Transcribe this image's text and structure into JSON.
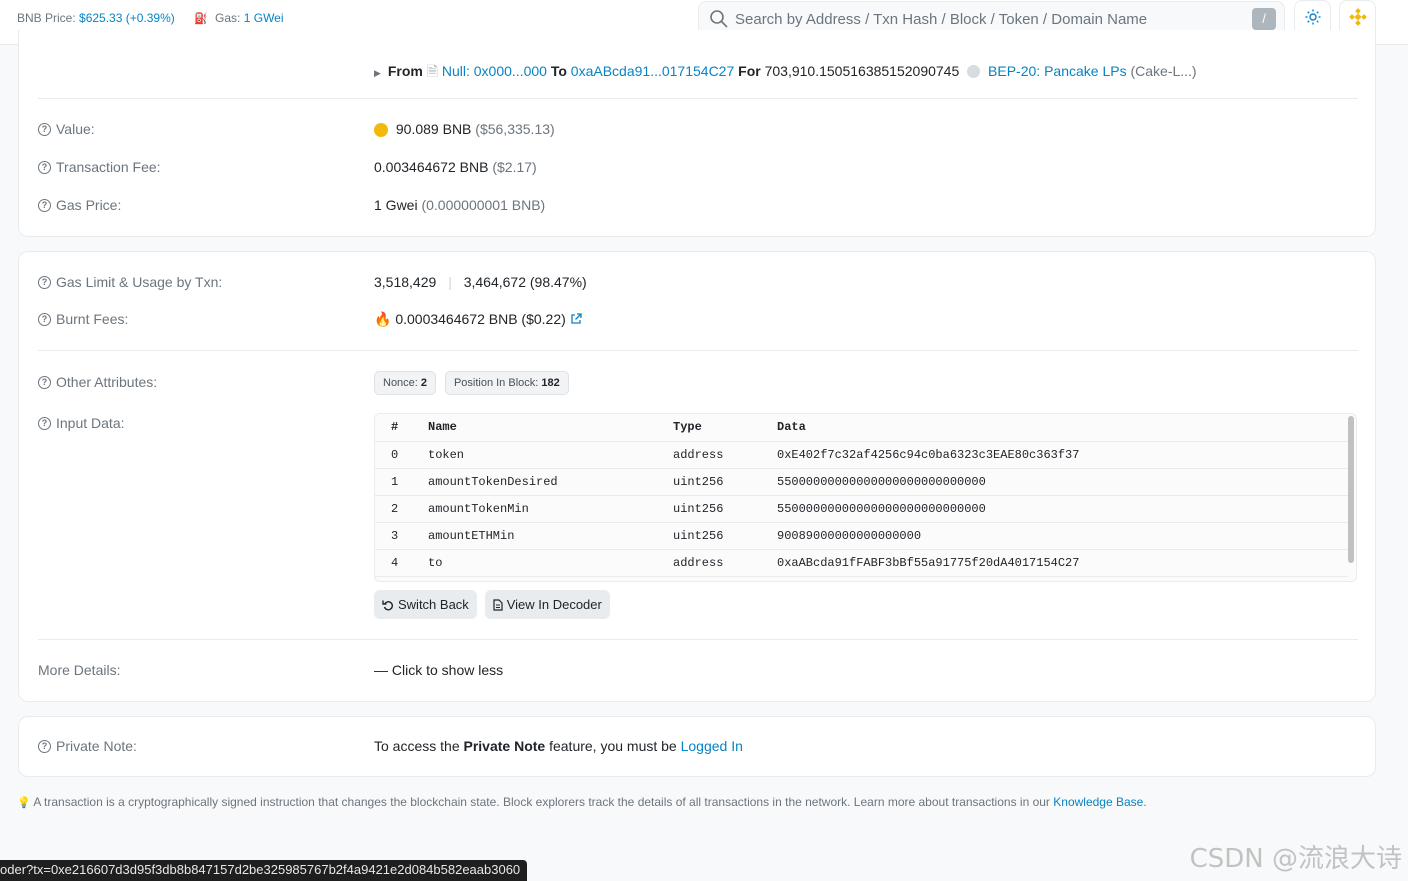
{
  "topbar": {
    "bnb_label": "BNB Price:",
    "bnb_value": "$625.33 (+0.39%)",
    "gas_label": "Gas:",
    "gas_value": "1 GWei",
    "search_placeholder": "Search by Address / Txn Hash / Block / Token / Domain Name",
    "search_shortcut": "/",
    "icons": [
      "search-icon",
      "theme-sun-icon",
      "bnb-logo-icon"
    ]
  },
  "transfer": {
    "from_label": "From",
    "from_value": "Null: 0x000...000",
    "to_label": "To",
    "to_value": "0xaABcda91...017154C27",
    "for_label": "For",
    "amount": "703,910.150516385152090745",
    "token_name": "BEP-20: Pancake LPs",
    "token_symbol": "(Cake-L...)"
  },
  "details": {
    "value_label": "Value:",
    "value_amount": "90.089 BNB",
    "value_usd": "($56,335.13)",
    "fee_label": "Transaction Fee:",
    "fee_amount": "0.003464672 BNB",
    "fee_usd": "($2.17)",
    "gasprice_label": "Gas Price:",
    "gasprice_amount": "1 Gwei",
    "gasprice_bnb": "(0.000000001 BNB)"
  },
  "more": {
    "gaslimit_label": "Gas Limit & Usage by Txn:",
    "gaslimit_value": "3,518,429",
    "gaslimit_sep": "|",
    "gasused_value": "3,464,672 (98.47%)",
    "burnt_label": "Burnt Fees:",
    "burnt_value": "0.0003464672 BNB ($0.22)",
    "other_label": "Other Attributes:",
    "nonce_label": "Nonce:",
    "nonce_value": "2",
    "position_label": "Position In Block:",
    "position_value": "182",
    "input_label": "Input Data:",
    "input_headers": [
      "#",
      "Name",
      "Type",
      "Data"
    ],
    "input_rows": [
      {
        "idx": "0",
        "name": "token",
        "type": "address",
        "data": "0xE402f7c32af4256c94c0ba6323c3EAE80c363f37",
        "is_link": true
      },
      {
        "idx": "1",
        "name": "amountTokenDesired",
        "type": "uint256",
        "data": "55000000000000000000000000000",
        "is_link": false
      },
      {
        "idx": "2",
        "name": "amountTokenMin",
        "type": "uint256",
        "data": "55000000000000000000000000000",
        "is_link": false
      },
      {
        "idx": "3",
        "name": "amountETHMin",
        "type": "uint256",
        "data": "90089000000000000000",
        "is_link": false
      },
      {
        "idx": "4",
        "name": "to",
        "type": "address",
        "data": "0xaABcda91fFABF3bBf55a91775f20dA4017154C27",
        "is_link": true
      }
    ],
    "switch_back": "Switch Back",
    "view_decoder": "View In Decoder",
    "more_details_label": "More Details:",
    "show_less": "— Click to show less"
  },
  "private_note": {
    "label": "Private Note:",
    "text_pre": "To access the ",
    "text_bold": "Private Note",
    "text_mid": " feature, you must be ",
    "text_link": "Logged In"
  },
  "footer": {
    "note": "A transaction is a cryptographically signed instruction that changes the blockchain state. Block explorers track the details of all transactions in the network. Learn more about transactions in our ",
    "link": "Knowledge Base",
    "end": "."
  },
  "statusbar": "oder?tx=0xe216607d3d95f3db8b847157d2be325985767b2f4a9421e2d084b582eaab3060",
  "watermark": "CSDN @流浪大诗",
  "colors": {
    "link": "#0784c3",
    "muted": "#6c757d",
    "text": "#212529",
    "border": "#e9ecef"
  }
}
